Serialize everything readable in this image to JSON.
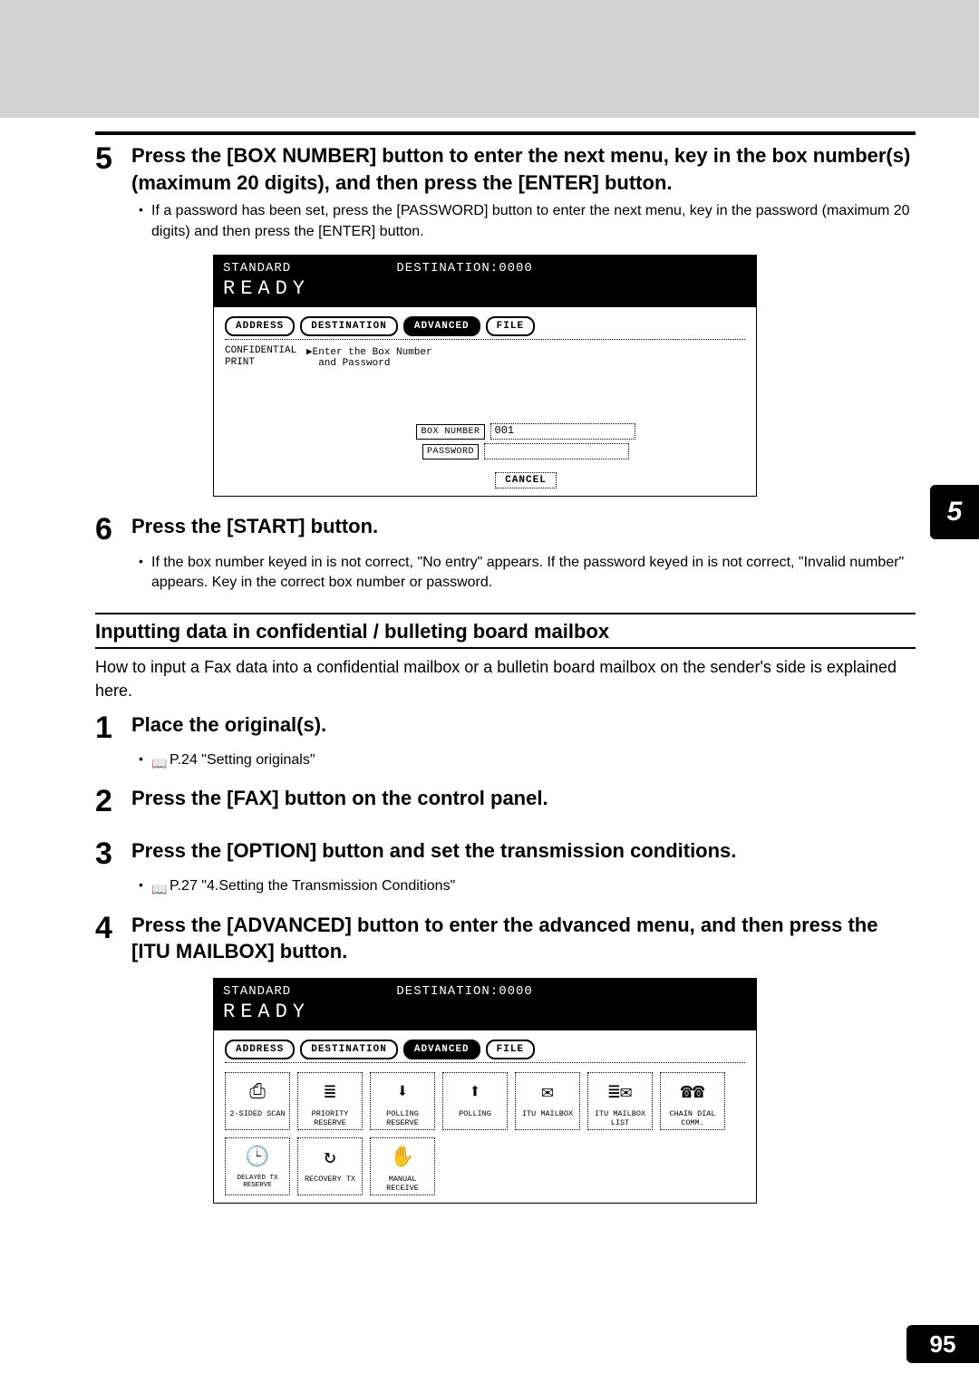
{
  "side_tab": "5",
  "page_number": "95",
  "step5": {
    "num": "5",
    "title": "Press the [BOX NUMBER] button to enter the next menu, key in the box number(s) (maximum 20 digits), and then press the [ENTER] button.",
    "bullet": "If a password has been set, press the [PASSWORD] button to enter the next menu, key in the password (maximum 20 digits) and then press the [ENTER] button."
  },
  "screen1": {
    "standard": "STANDARD",
    "destination": "DESTINATION:0000",
    "ready": "READY",
    "tabs": {
      "address": "ADDRESS",
      "destination_tab": "DESTINATION",
      "advanced": "ADVANCED",
      "file": "FILE"
    },
    "sidebar": "CONFIDENTIAL\nPRINT",
    "prompt": "▶Enter the Box Number\n  and Password",
    "box_number_label": "BOX NUMBER",
    "box_number_value": "001",
    "password_label": "PASSWORD",
    "cancel": "CANCEL"
  },
  "step6": {
    "num": "6",
    "title": "Press the [START] button.",
    "bullet": "If the box number keyed in is not correct, \"No entry\" appears. If the password keyed in is not correct, \"Invalid number\" appears. Key in the correct box number or password."
  },
  "subsection": {
    "heading": "Inputting data in confidential / bulleting board mailbox",
    "intro": "How to input a Fax data into a confidential mailbox or a bulletin board mailbox on the sender's side is explained here."
  },
  "step1": {
    "num": "1",
    "title": "Place the original(s).",
    "ref": "P.24 \"Setting originals\""
  },
  "step2": {
    "num": "2",
    "title": "Press the [FAX] button on the control panel."
  },
  "step3": {
    "num": "3",
    "title": "Press the [OPTION] button and set the transmission conditions.",
    "ref": "P.27 \"4.Setting the Transmission Conditions\""
  },
  "step4": {
    "num": "4",
    "title": "Press the [ADVANCED] button to enter the advanced menu, and then press the [ITU MAILBOX] button."
  },
  "screen2": {
    "standard": "STANDARD",
    "destination": "DESTINATION:0000",
    "ready": "READY",
    "tabs": {
      "address": "ADDRESS",
      "destination_tab": "DESTINATION",
      "advanced": "ADVANCED",
      "file": "FILE"
    },
    "row1": {
      "c1": "2-SIDED SCAN",
      "c2": "PRIORITY RESERVE",
      "c3": "POLLING RESERVE",
      "c4": "POLLING",
      "c5": "ITU MAILBOX",
      "c6": "ITU MAILBOX LIST",
      "c7": "CHAIN DIAL COMM."
    },
    "row2": {
      "c1a": "DELAYED TX",
      "c1b": "RESERVE",
      "c2": "RECOVERY TX",
      "c3": "MANUAL RECEIVE"
    }
  }
}
